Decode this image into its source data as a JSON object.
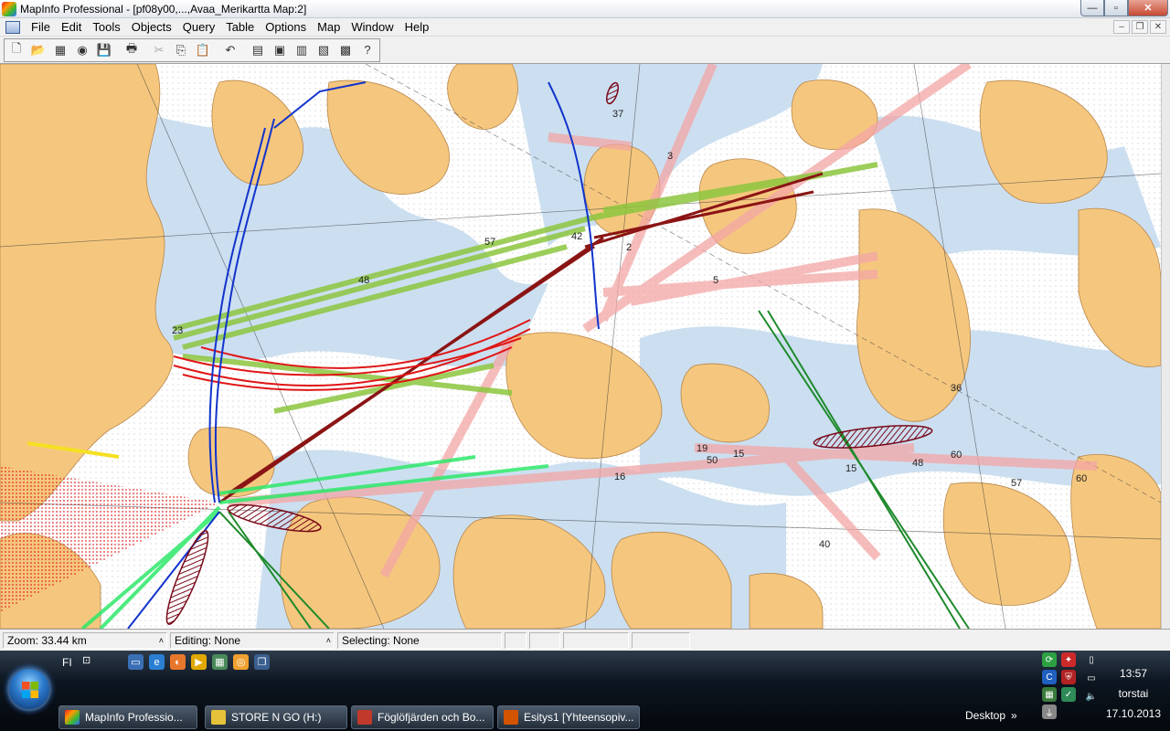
{
  "window": {
    "title": "MapInfo Professional - [pf08y00,...,Avaa_Merikartta Map:2]",
    "minimize": "—",
    "maximize": "▫",
    "close": "✕"
  },
  "menu": [
    "File",
    "Edit",
    "Tools",
    "Objects",
    "Query",
    "Table",
    "Options",
    "Map",
    "Window",
    "Help"
  ],
  "mdi": {
    "minimize": "–",
    "restore": "❐",
    "close": "✕"
  },
  "toolbar": {
    "new": "🗋",
    "open": "📂",
    "open_workspace": "▦",
    "open_dbms": "◉",
    "save": "💾",
    "print": "🖶",
    "cut": "✂",
    "copy": "⎘",
    "paste": "📋",
    "undo": "↶",
    "new_browser": "▤",
    "new_mapper": "▣",
    "new_grapher": "▥",
    "new_layout": "▧",
    "redistrict": "▩",
    "help": "?"
  },
  "map": {
    "labels": [
      "37",
      "3",
      "57",
      "42",
      "2",
      "48",
      "5",
      "23",
      "36",
      "19",
      "15",
      "50",
      "60",
      "48",
      "57",
      "16",
      "60",
      "40",
      "15"
    ]
  },
  "status": {
    "zoom": "Zoom: 33.44 km",
    "editing": "Editing: None",
    "selecting": "Selecting: None"
  },
  "taskbar": {
    "language": "FI",
    "tasks": [
      {
        "label": "MapInfo Professio...",
        "color": "#e8602c"
      },
      {
        "label": "STORE N GO (H:)",
        "color": "#e6c23b"
      },
      {
        "label": "Föglöfjärden och Bo...",
        "color": "#c0392b"
      },
      {
        "label": "Esitys1 [Yhteensopiv...",
        "color": "#d35400"
      }
    ],
    "desktop": "Desktop",
    "chevron": "»",
    "time": "13:57",
    "day": "torstai",
    "date": "17.10.2013"
  }
}
